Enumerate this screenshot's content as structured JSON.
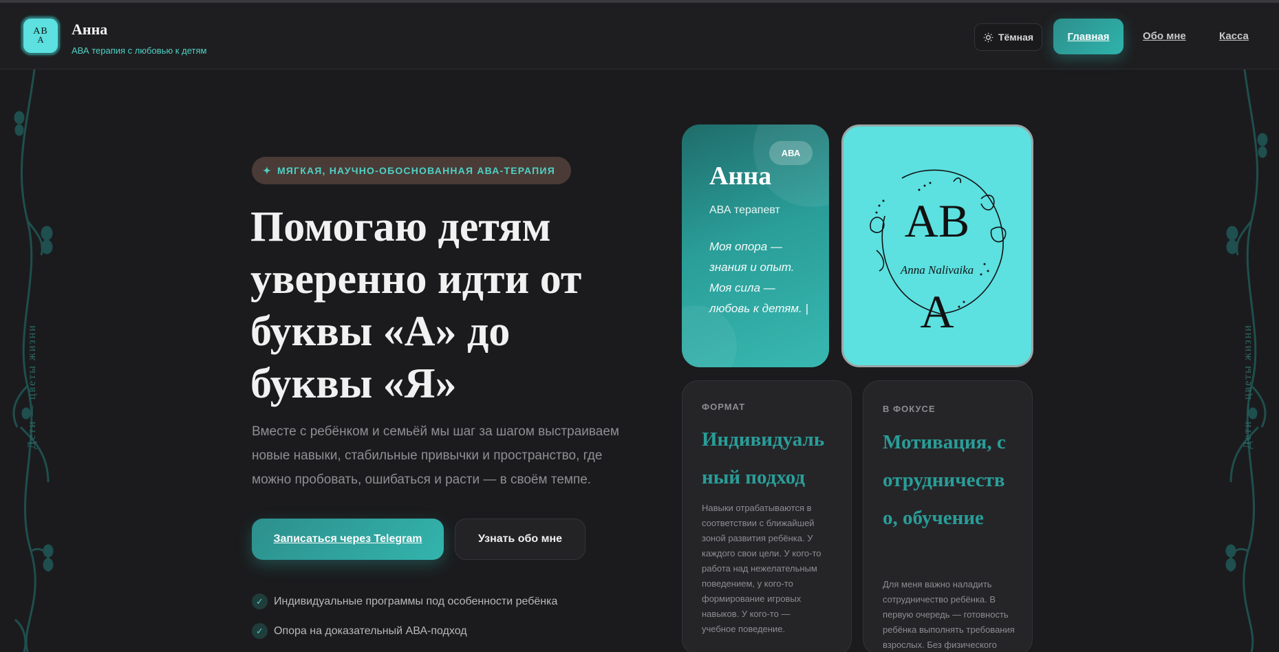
{
  "header": {
    "logo_line1": "AB",
    "logo_line2": "A",
    "brand_name": "Анна",
    "brand_subtitle": "АВА терапия с любовью к детям",
    "theme_label": "Тёмная",
    "nav": {
      "home": "Главная",
      "about": "Обо мне",
      "cash": "Касса"
    }
  },
  "side": {
    "left_text": "Дети — цветы жизни",
    "right_text": "Дети — цветы жизни"
  },
  "hero": {
    "pill_icon": "✦",
    "pill_text": "МЯГКАЯ, НАУЧНО-ОБОСНОВАННАЯ АВА-ТЕРАПИЯ",
    "title": "Помогаю детям уверенно идти от буквы «А» до буквы «Я»",
    "description": "Вместе с ребёнком и семьёй мы шаг за шагом выстраиваем новые навыки, стабильные привычки и пространство, где можно пробовать, ошибаться и расти — в своём темпе.",
    "cta_telegram": "Записаться через Telegram",
    "cta_about": "Узнать обо мне",
    "checks": [
      "Индивидуальные программы под особенности ребёнка",
      "Опора на доказательный АВА-подход"
    ]
  },
  "card_anna": {
    "badge": "АВА",
    "name": "Анна",
    "role": "АВА терапевт",
    "quote": "Моя опора — знания и опыт. Моя сила — любовь к детям. |"
  },
  "card_logo": {
    "big_letters_top": "AB",
    "script_name": "Anna Nalivaika",
    "big_letter_bottom": "A"
  },
  "card_format": {
    "label": "ФОРМАТ",
    "title": "Индивидуальный подход",
    "text": "Навыки отрабатываются в соответствии с ближайшей зоной развития ребёнка. У каждого свои цели. У кого-то работа над нежелательным поведением, у кого-то формирование игровых навыков. У кого-то — учебное поведение."
  },
  "card_focus": {
    "label": "В ФОКУСЕ",
    "title": "Мотивация, сотрудничество, обучение",
    "text": "Для меня важно наладить сотрудничество ребёнка. В первую очередь — готовность ребёнка выполнять требования взрослых. Без физического"
  },
  "colors": {
    "accent": "#2fb3ac",
    "teal_text": "#4fd1c5",
    "logo_bg": "#5ce0e0",
    "background": "#1b1b1d"
  }
}
